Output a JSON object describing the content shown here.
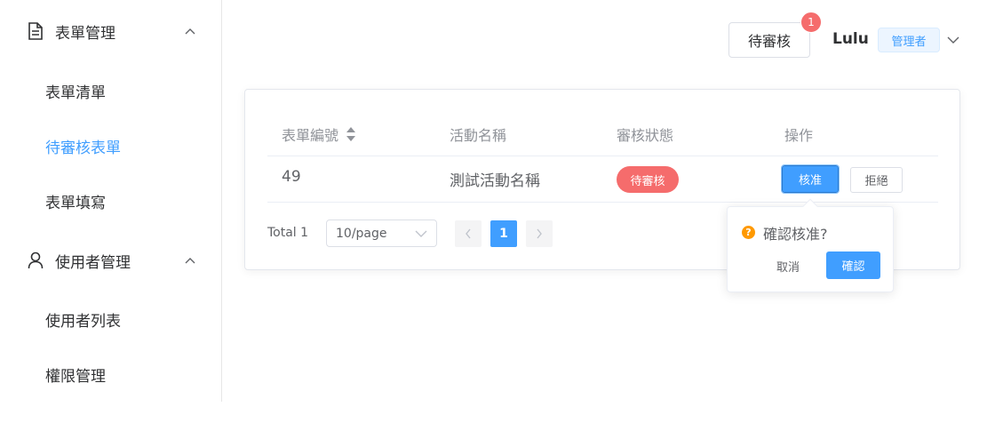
{
  "sidebar": {
    "groups": [
      {
        "label": "表單管理",
        "icon": "document-icon",
        "expanded": true,
        "items": [
          {
            "label": "表單清單",
            "active": false
          },
          {
            "label": "待審核表單",
            "active": true
          },
          {
            "label": "表單填寫",
            "active": false
          }
        ]
      },
      {
        "label": "使用者管理",
        "icon": "user-icon",
        "expanded": true,
        "items": [
          {
            "label": "使用者列表",
            "active": false
          },
          {
            "label": "權限管理",
            "active": false
          }
        ]
      }
    ]
  },
  "header": {
    "pending_button_label": "待審核",
    "pending_badge_count": "1",
    "username": "Lulu",
    "role_tag": "管理者"
  },
  "table": {
    "columns": [
      {
        "label": "表單編號",
        "sortable": true
      },
      {
        "label": "活動名稱"
      },
      {
        "label": "審核狀態"
      },
      {
        "label": "操作"
      }
    ],
    "rows": [
      {
        "id": "49",
        "activity_name": "測試活動名稱",
        "status": "待審核",
        "approve_label": "核准",
        "reject_label": "拒絕"
      }
    ]
  },
  "pagination": {
    "total_text": "Total 1",
    "page_size": "10/page",
    "current_page": "1",
    "prev_icon": "chevron-left-icon",
    "next_icon": "chevron-right-icon"
  },
  "popconfirm": {
    "title": "確認核准?",
    "cancel_label": "取消",
    "confirm_label": "確認"
  },
  "colors": {
    "primary": "#409eff",
    "danger": "#f56c6c",
    "warning": "#ff9900",
    "text": "#303133",
    "muted": "#909399"
  }
}
